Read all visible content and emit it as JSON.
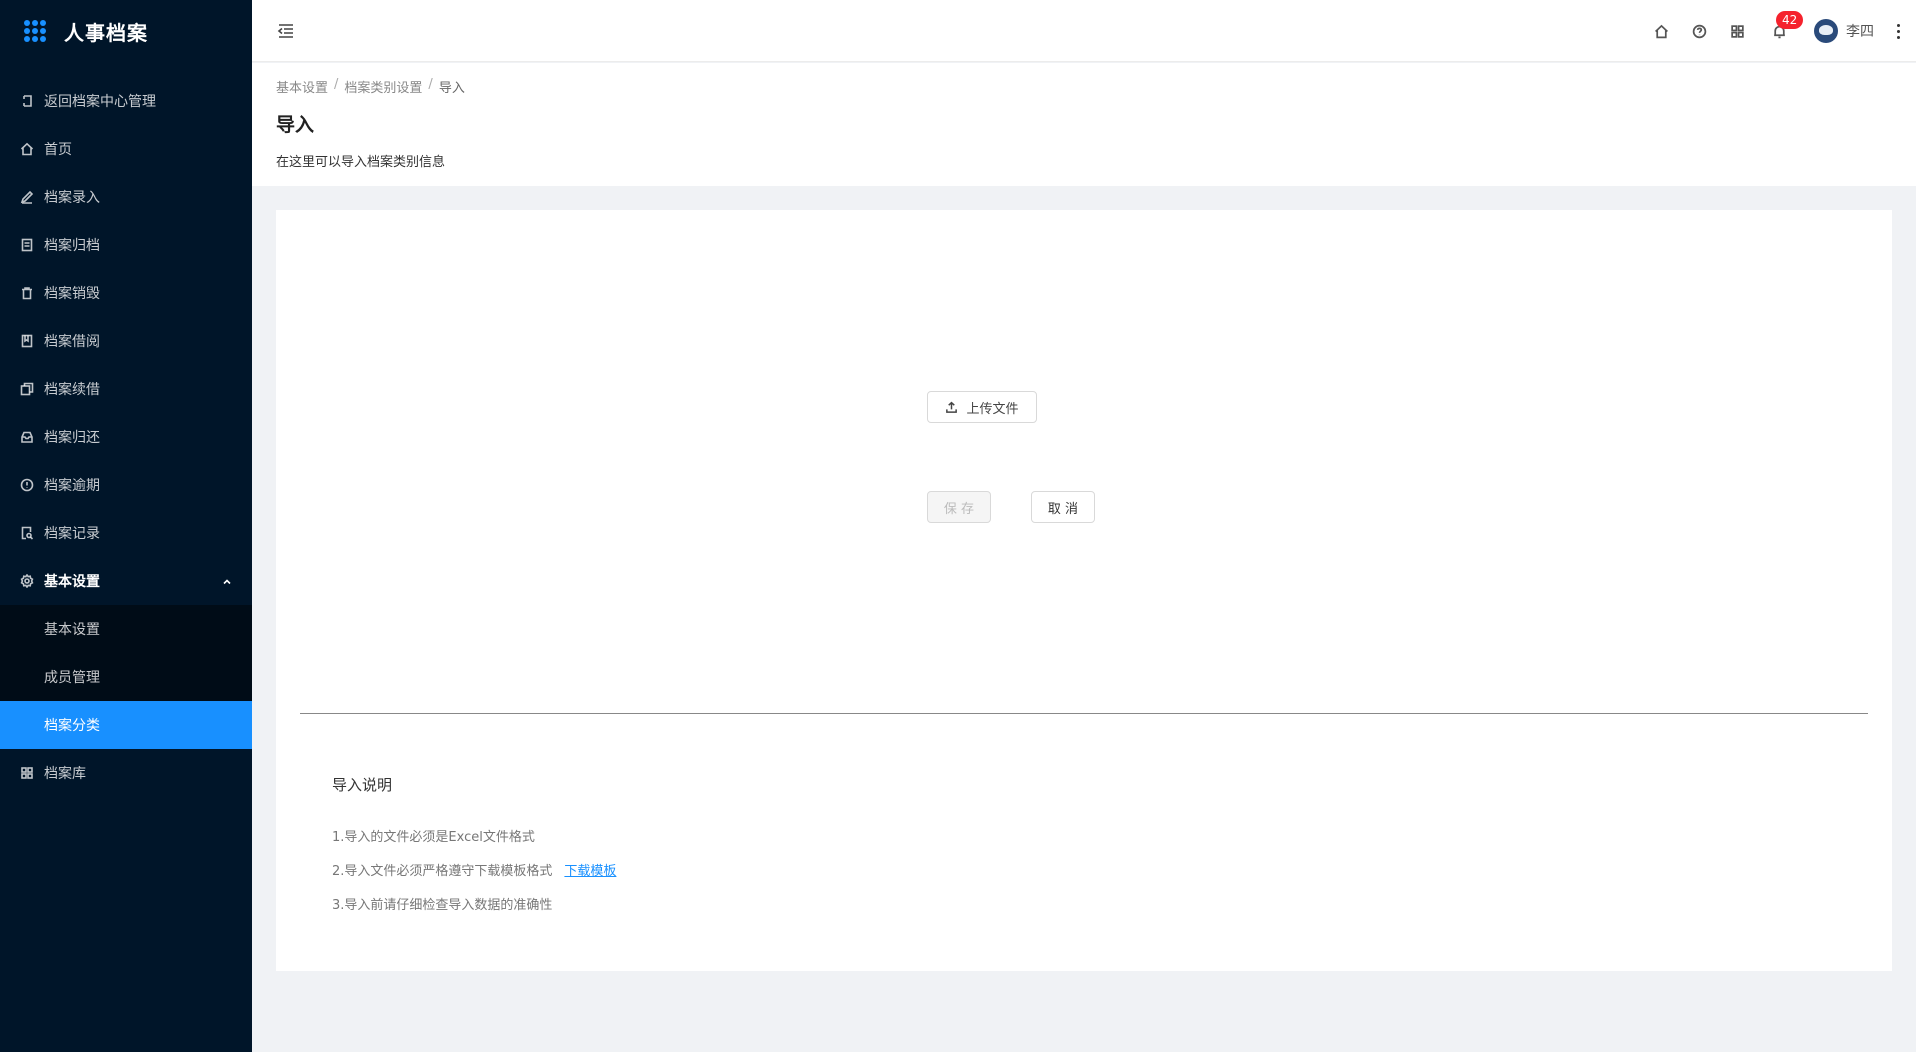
{
  "app": {
    "title": "人事档案"
  },
  "sidebar": {
    "items": [
      {
        "label": "返回档案中心管理",
        "icon": "return-icon"
      },
      {
        "label": "首页",
        "icon": "home-icon"
      },
      {
        "label": "档案录入",
        "icon": "edit-icon"
      },
      {
        "label": "档案归档",
        "icon": "archive-doc-icon"
      },
      {
        "label": "档案销毁",
        "icon": "trash-icon"
      },
      {
        "label": "档案借阅",
        "icon": "book-icon"
      },
      {
        "label": "档案续借",
        "icon": "copy-icon"
      },
      {
        "label": "档案归还",
        "icon": "inbox-icon"
      },
      {
        "label": "档案逾期",
        "icon": "alert-circle-icon"
      },
      {
        "label": "档案记录",
        "icon": "record-search-icon"
      }
    ],
    "settings": {
      "label": "基本设置",
      "icon": "settings-icon",
      "children": [
        "基本设置",
        "成员管理",
        "档案分类"
      ]
    },
    "library": {
      "label": "档案库",
      "icon": "grid-icon"
    }
  },
  "header": {
    "notification_count": "42",
    "user_name": "李四",
    "icons": [
      "home-icon",
      "help-icon",
      "apps-icon",
      "bell-icon"
    ]
  },
  "breadcrumb": [
    "基本设置",
    "档案类别设置",
    "导入"
  ],
  "page": {
    "title": "导入",
    "description": "在这里可以导入档案类别信息"
  },
  "form": {
    "upload_label": "上传文件",
    "save_label": "保 存",
    "cancel_label": "取 消"
  },
  "notes": {
    "title": "导入说明",
    "items": [
      "1.导入的文件必须是Excel文件格式",
      "2.导入文件必须严格遵守下载模板格式",
      "3.导入前请仔细检查导入数据的准确性"
    ],
    "download_link": "下载模板"
  }
}
